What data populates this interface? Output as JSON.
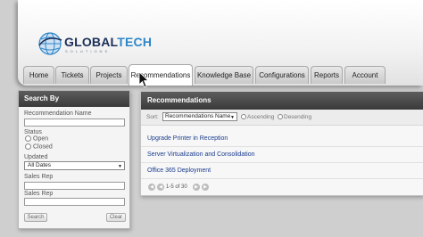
{
  "logo": {
    "brand_a": "GLOBAL",
    "brand_b": "TECH",
    "tagline": "SOLUTIONS"
  },
  "tabs": [
    {
      "label": "Home"
    },
    {
      "label": "Tickets"
    },
    {
      "label": "Projects"
    },
    {
      "label": "Recommendations",
      "active": true
    },
    {
      "label": "Knowledge Base"
    },
    {
      "label": "Configurations"
    },
    {
      "label": "Reports"
    },
    {
      "label": "Account"
    }
  ],
  "search": {
    "title": "Search By",
    "recommendation_name_label": "Recommendation Name",
    "recommendation_name_value": "",
    "status_label": "Status",
    "status_options": [
      "Open",
      "Closed"
    ],
    "updated_label": "Updated",
    "updated_value": "All Dates",
    "sales_rep_label_1": "Sales Rep",
    "sales_rep_value_1": "",
    "sales_rep_label_2": "Sales Rep",
    "sales_rep_value_2": "",
    "search_button": "Search",
    "clear_button": "Clear"
  },
  "results": {
    "title": "Recommendations",
    "sort_label": "Sort:",
    "sort_value": "Recommendations Name",
    "sort_ascending": "Ascending",
    "sort_descending": "Desending",
    "items": [
      "Upgrade Printer in Reception",
      "Server Virtualization and Consolidation",
      "Office 365 Deployment"
    ],
    "pager_text": "1-5 of 30"
  },
  "colors": {
    "link": "#1a3c8c",
    "header_dark": "#3a3a3a",
    "brand_navy": "#1b2f58",
    "brand_blue": "#2f86c9"
  }
}
